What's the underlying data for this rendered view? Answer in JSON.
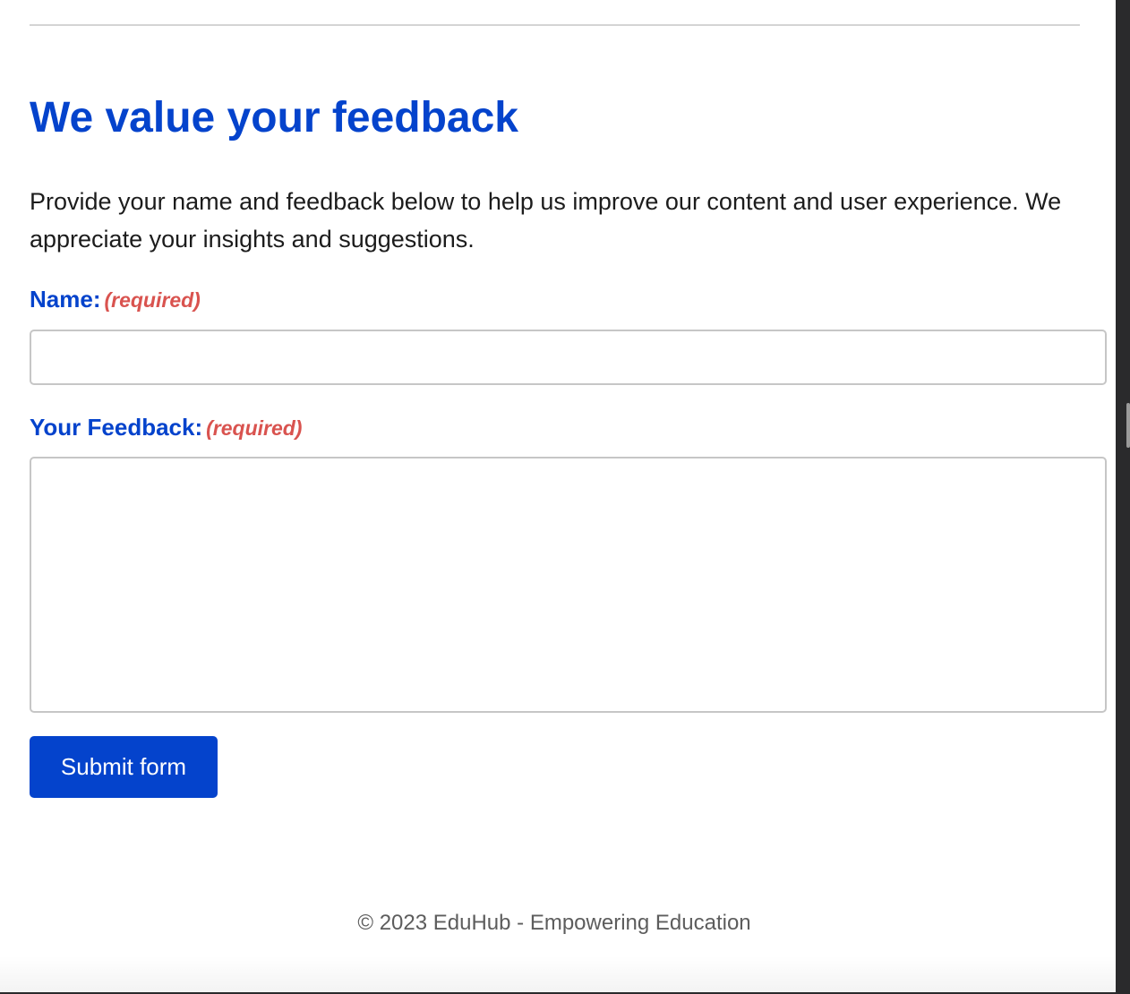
{
  "form_section": {
    "heading": "We value your feedback",
    "intro": "Provide your name and feedback below to help us improve our content and user experience. We appreciate your insights and suggestions.",
    "name_field": {
      "label": "Name:",
      "required_note": "(required)",
      "value": ""
    },
    "feedback_field": {
      "label": "Your Feedback:",
      "required_note": "(required)",
      "value": ""
    },
    "submit_label": "Submit form"
  },
  "footer": {
    "text": "© 2023 EduHub - Empowering Education"
  },
  "colors": {
    "accent": "#0443cc",
    "required": "#d9534f",
    "body_text": "#1c1c1c",
    "footer_text": "#5d5d5d",
    "input_border": "#c6c6c6"
  }
}
